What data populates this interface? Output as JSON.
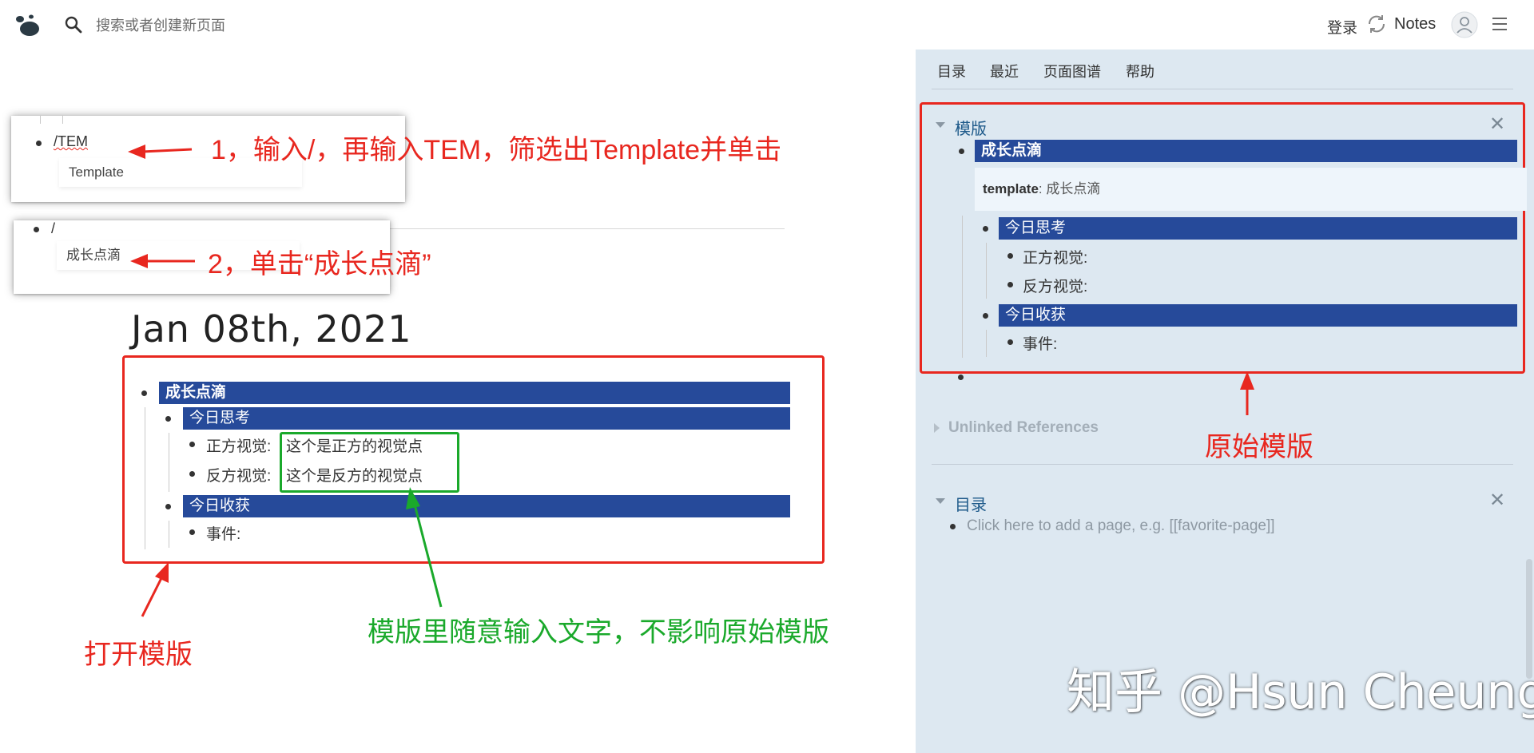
{
  "header": {
    "search_placeholder": "搜索或者创建新页面",
    "login": "登录",
    "notes": "Notes"
  },
  "popups": {
    "first": {
      "typed": "/TEM",
      "option": "Template"
    },
    "second": {
      "typed": "/",
      "option": "成长点滴"
    }
  },
  "annotations": {
    "step1": "1，输入/，再输入TEM，筛选出Template并单击",
    "step2": "2，单击“成长点滴”",
    "open_template": "打开模版",
    "free_input": "模版里随意输入文字，不影响原始模版",
    "original_template": "原始模版"
  },
  "journal": {
    "title": "Jan 08th, 2021",
    "root": "成长点滴",
    "thinking": "今日思考",
    "positive_label": "正方视觉:",
    "positive_value": "这个是正方的视觉点",
    "negative_label": "反方视觉:",
    "negative_value": "这个是反方的视觉点",
    "harvest": "今日收获",
    "event_label": "事件:"
  },
  "sidebar": {
    "tabs": [
      "目录",
      "最近",
      "页面图谱",
      "帮助"
    ],
    "template_panel": {
      "title": "模版",
      "root": "成长点滴",
      "prop_key": "template",
      "prop_value": ": 成长点滴",
      "thinking": "今日思考",
      "positive": "正方视觉:",
      "negative": "反方视觉:",
      "harvest": "今日收获",
      "event": "事件:"
    },
    "unlinked": "Unlinked References",
    "contents_panel": {
      "title": "目录",
      "placeholder": "Click here to add a page, e.g. [[favorite-page]]"
    }
  },
  "watermark": "知乎 @Hsun Cheung",
  "colors": {
    "highlight": "#264a9a",
    "annotation_red": "#e8271f",
    "annotation_green": "#1aa92b",
    "sidebar_bg": "#dde8f1"
  }
}
